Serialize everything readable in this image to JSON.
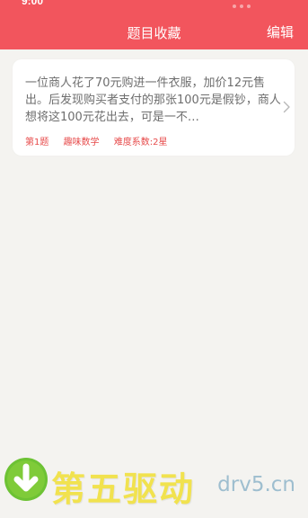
{
  "header": {
    "title": "题目收藏",
    "edit_label": "编辑"
  },
  "status_fragment": "9:00",
  "card": {
    "text": "一位商人花了70元购进一件衣服，加价12元售出。后发现购买者支付的那张100元是假钞，商人想将这100元花出去，可是一不…",
    "number": "第1题",
    "category": "趣味数学",
    "difficulty": "难度系数:2星"
  },
  "watermark": {
    "brand": "第五驱动",
    "url": "drv5.cn"
  },
  "colors": {
    "header": "#f2555d",
    "background": "#f4f3f0",
    "accent_text": "#e74b4b",
    "watermark_text": "#f1e24e",
    "watermark_icon": "#6dc234"
  }
}
